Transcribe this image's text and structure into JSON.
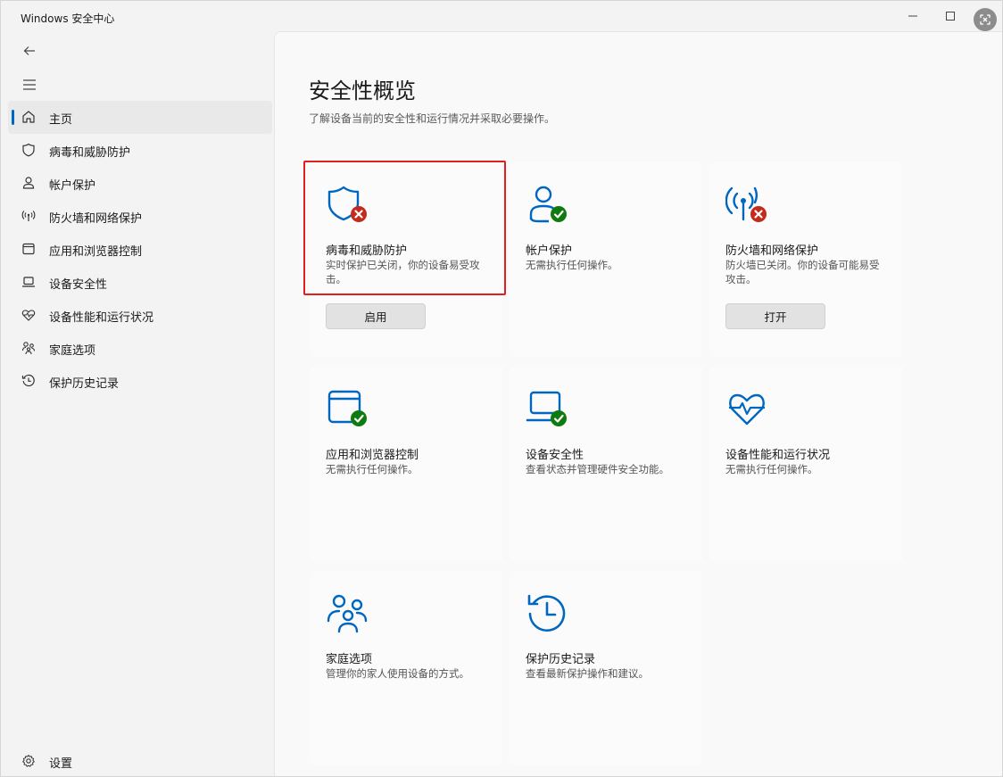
{
  "window": {
    "title": "Windows 安全中心"
  },
  "nav": {
    "items": [
      {
        "label": "主页",
        "icon": "home-icon"
      },
      {
        "label": "病毒和威胁防护",
        "icon": "shield-icon"
      },
      {
        "label": "帐户保护",
        "icon": "person-icon"
      },
      {
        "label": "防火墙和网络保护",
        "icon": "wifi-icon"
      },
      {
        "label": "应用和浏览器控制",
        "icon": "app-window-icon"
      },
      {
        "label": "设备安全性",
        "icon": "laptop-icon"
      },
      {
        "label": "设备性能和运行状况",
        "icon": "heart-icon"
      },
      {
        "label": "家庭选项",
        "icon": "family-icon"
      },
      {
        "label": "保护历史记录",
        "icon": "history-icon"
      }
    ],
    "settings_label": "设置"
  },
  "main": {
    "title": "安全性概览",
    "subtitle": "了解设备当前的安全性和运行情况并采取必要操作。",
    "cards": [
      {
        "title": "病毒和威胁防护",
        "desc": "实时保护已关闭，你的设备易受攻击。",
        "status": "error",
        "button": "启用",
        "icon": "shield-icon"
      },
      {
        "title": "帐户保护",
        "desc": "无需执行任何操作。",
        "status": "ok",
        "icon": "person-icon"
      },
      {
        "title": "防火墙和网络保护",
        "desc": "防火墙已关闭。你的设备可能易受攻击。",
        "status": "error",
        "button": "打开",
        "icon": "wifi-icon"
      },
      {
        "title": "应用和浏览器控制",
        "desc": "无需执行任何操作。",
        "status": "ok",
        "icon": "app-window-icon"
      },
      {
        "title": "设备安全性",
        "desc": "查看状态并管理硬件安全功能。",
        "status": "ok",
        "icon": "laptop-icon"
      },
      {
        "title": "设备性能和运行状况",
        "desc": "无需执行任何操作。",
        "status": "none",
        "icon": "heart-pulse-icon"
      },
      {
        "title": "家庭选项",
        "desc": "管理你的家人使用设备的方式。",
        "status": "none",
        "icon": "family-icon"
      },
      {
        "title": "保护历史记录",
        "desc": "查看最新保护操作和建议。",
        "status": "none",
        "icon": "history-icon"
      }
    ]
  },
  "colors": {
    "accent": "#0067c0",
    "error": "#c42b1c",
    "ok": "#0f7b0f",
    "highlight": "#e02020"
  }
}
